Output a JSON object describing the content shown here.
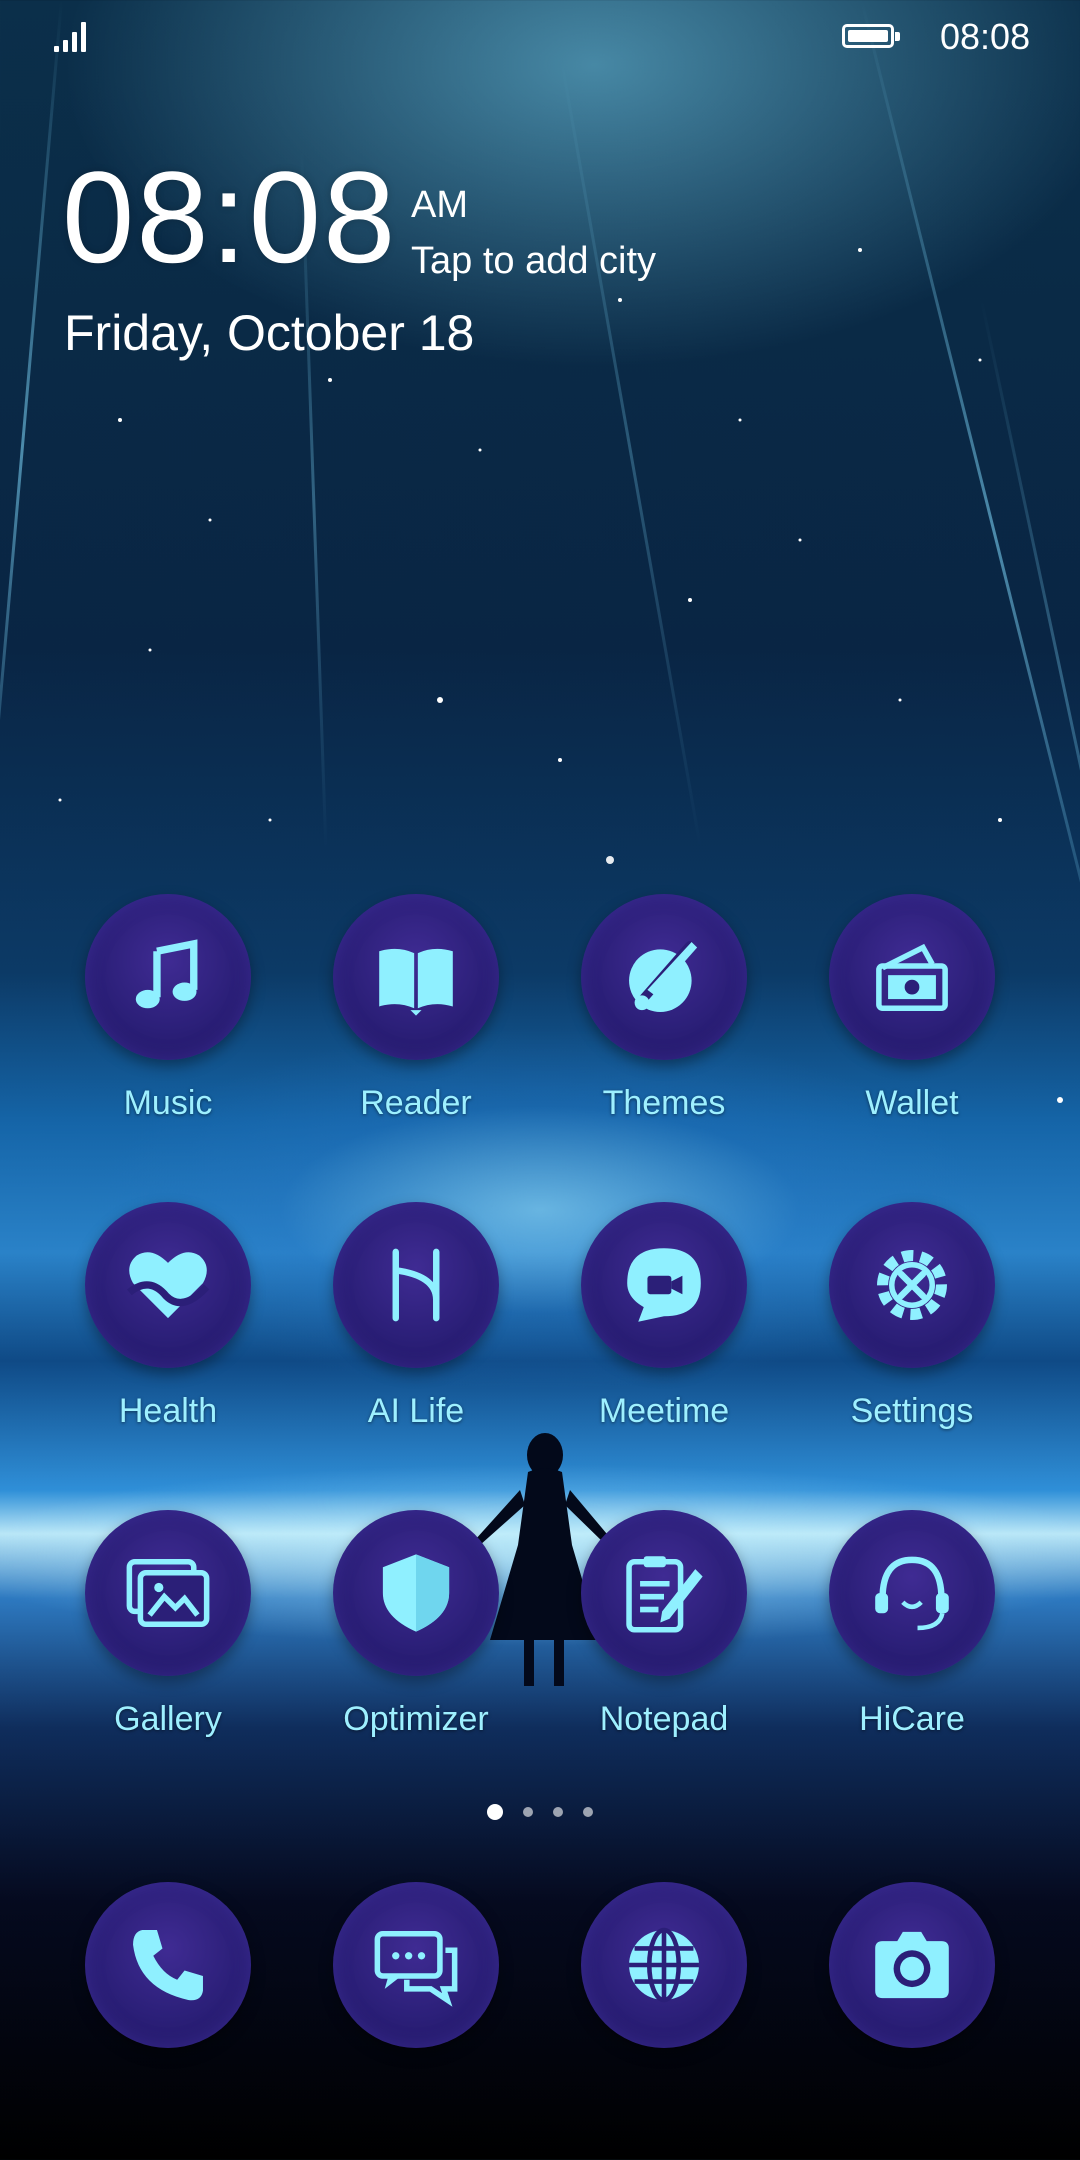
{
  "status_bar": {
    "time": "08:08",
    "battery_level": 1.0,
    "signal_bars": 4
  },
  "clock_widget": {
    "time": "08:08",
    "ampm": "AM",
    "city_hint": "Tap to add city",
    "date": "Friday, October 18"
  },
  "apps": [
    {
      "label": "Music",
      "icon": "music-note-icon"
    },
    {
      "label": "Reader",
      "icon": "book-icon"
    },
    {
      "label": "Themes",
      "icon": "paintbrush-icon"
    },
    {
      "label": "Wallet",
      "icon": "wallet-icon"
    },
    {
      "label": "Health",
      "icon": "heart-icon"
    },
    {
      "label": "AI Life",
      "icon": "ai-life-icon"
    },
    {
      "label": "Meetime",
      "icon": "video-chat-icon"
    },
    {
      "label": "Settings",
      "icon": "gear-icon"
    },
    {
      "label": "Gallery",
      "icon": "gallery-icon"
    },
    {
      "label": "Optimizer",
      "icon": "shield-icon"
    },
    {
      "label": "Notepad",
      "icon": "notepad-icon"
    },
    {
      "label": "HiCare",
      "icon": "headset-icon"
    }
  ],
  "page_indicator": {
    "pages": 4,
    "current": 1
  },
  "dock": [
    {
      "icon": "phone-icon"
    },
    {
      "icon": "messages-icon"
    },
    {
      "icon": "browser-globe-icon"
    },
    {
      "icon": "camera-icon"
    }
  ],
  "colors": {
    "icon_bg": "#2b1f78",
    "icon_glyph": "#8ff0ff",
    "label": "#9ef0ff"
  }
}
